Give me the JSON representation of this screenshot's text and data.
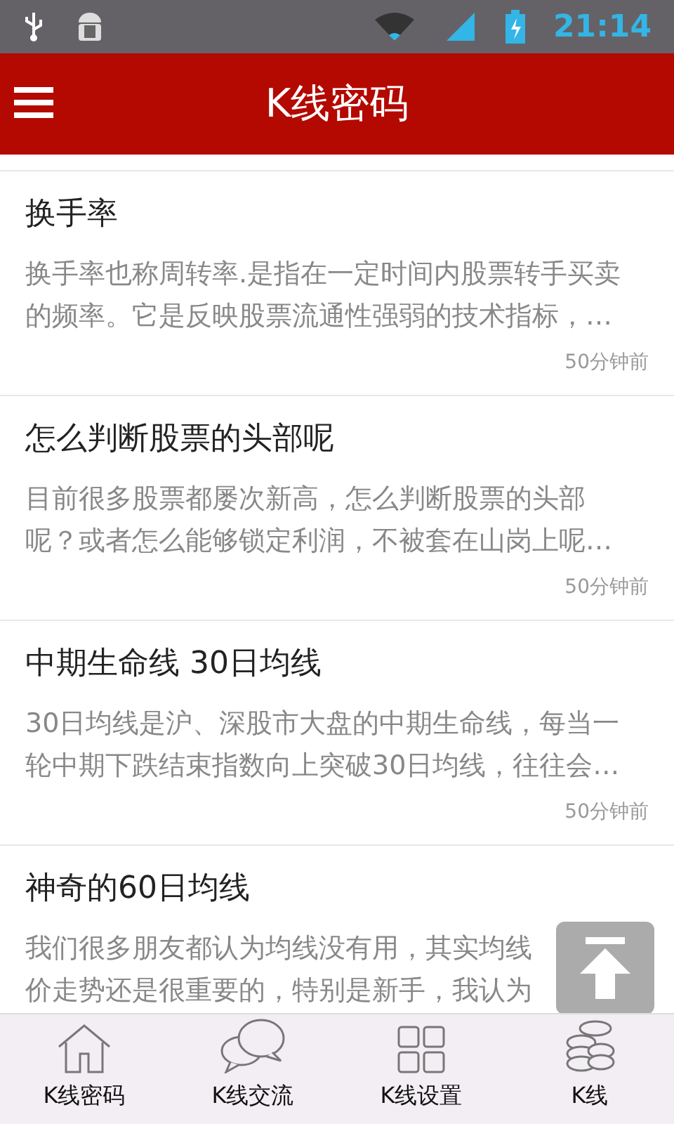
{
  "status_bar": {
    "time": "21:14"
  },
  "header": {
    "title": "K线密码"
  },
  "articles": [
    {
      "title": "换手率",
      "summary_lines": [
        "换手率也称周转率.是指在一定时间内股票转手买卖",
        "的频率。它是反映股票流通性强弱的技术指标，…"
      ],
      "time": "50分钟前"
    },
    {
      "title": "怎么判断股票的头部呢",
      "summary_lines": [
        "目前很多股票都屡次新高，怎么判断股票的头部",
        "呢？或者怎么能够锁定利润，不被套在山岗上呢…"
      ],
      "time": "50分钟前"
    },
    {
      "title": "中期生命线 30日均线",
      "summary_lines": [
        "30日均线是沪、深股市大盘的中期生命线，每当一",
        "轮中期下跌结束指数向上突破30日均线，往往会…"
      ],
      "time": "50分钟前"
    },
    {
      "title": "神奇的60日均线",
      "summary_lines": [
        "我们很多朋友都认为均线没有用，其实均线",
        "价走势还是很重要的，特别是新手，我认为"
      ]
    }
  ],
  "bottom_nav": [
    {
      "kind": "home",
      "label": "K线密码"
    },
    {
      "kind": "chat",
      "label": "K线交流"
    },
    {
      "kind": "grid",
      "label": "K线设置"
    },
    {
      "kind": "coins",
      "label": "K线"
    }
  ]
}
